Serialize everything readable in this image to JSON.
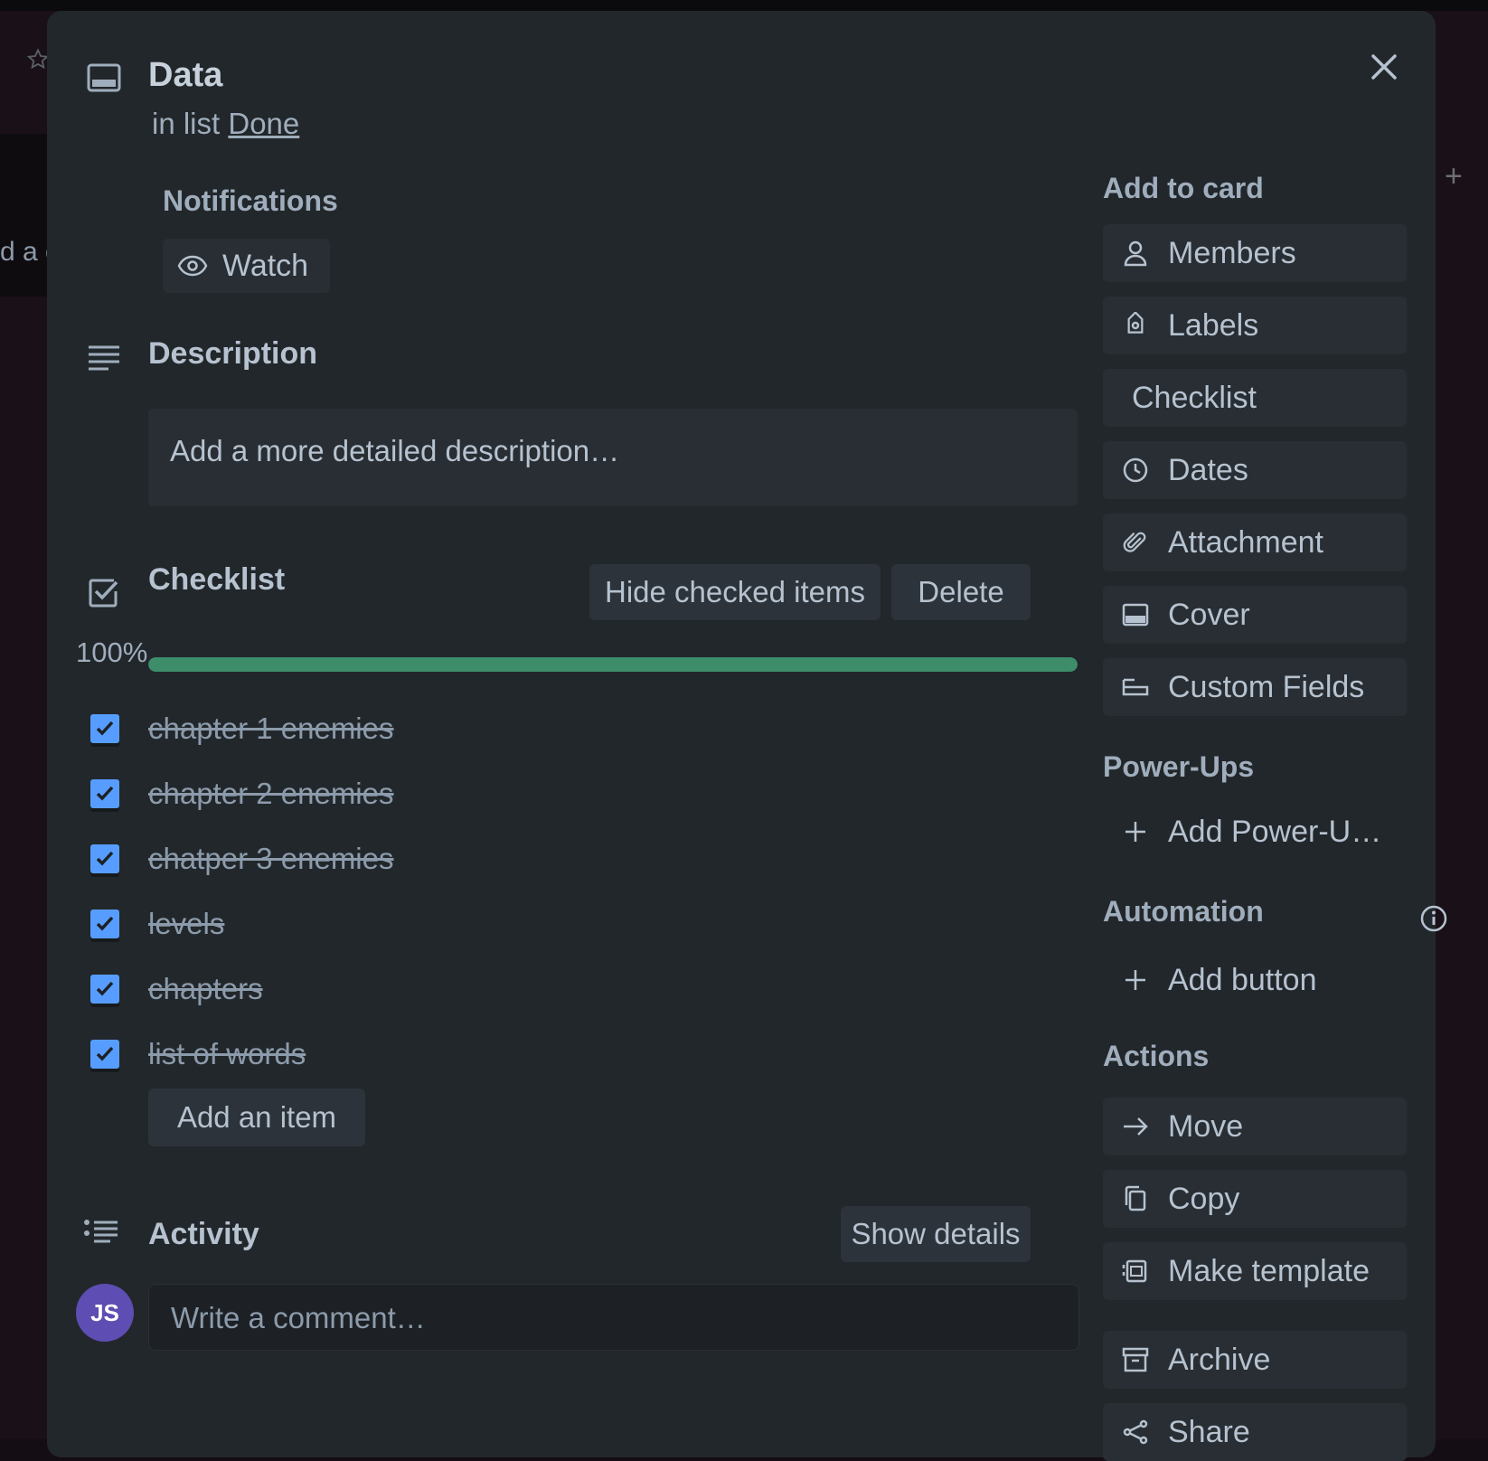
{
  "card": {
    "title": "Data",
    "list_prefix": "in list",
    "list_name": "Done"
  },
  "background": {
    "card_fragment": "d a c"
  },
  "notifications": {
    "heading": "Notifications",
    "watch_label": "Watch"
  },
  "description": {
    "heading": "Description",
    "placeholder": "Add a more detailed description…"
  },
  "checklist": {
    "heading": "Checklist",
    "hide_checked_label": "Hide checked items",
    "delete_label": "Delete",
    "progress_text": "100%",
    "progress_value": 1.0,
    "items": [
      {
        "label": "chapter 1 enemies",
        "checked": true
      },
      {
        "label": "chapter 2 enemies",
        "checked": true
      },
      {
        "label": "chatper 3 enemies",
        "checked": true
      },
      {
        "label": "levels",
        "checked": true
      },
      {
        "label": "chapters",
        "checked": true
      },
      {
        "label": "list of words",
        "checked": true
      }
    ],
    "add_item_label": "Add an item"
  },
  "activity": {
    "heading": "Activity",
    "show_details_label": "Show details",
    "avatar_initials": "JS",
    "comment_placeholder": "Write a comment…"
  },
  "sidebar": {
    "add_to_card_heading": "Add to card",
    "add_to_card": [
      {
        "label": "Members",
        "icon": "person-icon"
      },
      {
        "label": "Labels",
        "icon": "tag-icon"
      },
      {
        "label": "Checklist",
        "icon": ""
      },
      {
        "label": "Dates",
        "icon": "clock-icon"
      },
      {
        "label": "Attachment",
        "icon": "paperclip-icon"
      },
      {
        "label": "Cover",
        "icon": "cover-icon"
      },
      {
        "label": "Custom Fields",
        "icon": "custom-fields-icon"
      }
    ],
    "power_ups_heading": "Power-Ups",
    "add_power_up_label": "Add Power-U…",
    "automation_heading": "Automation",
    "add_button_label": "Add button",
    "actions_heading": "Actions",
    "actions": [
      {
        "label": "Move",
        "icon": "arrow-right-icon"
      },
      {
        "label": "Copy",
        "icon": "copy-icon"
      },
      {
        "label": "Make template",
        "icon": "template-icon"
      },
      {
        "label": "Archive",
        "icon": "archive-icon"
      },
      {
        "label": "Share",
        "icon": "share-icon"
      }
    ]
  },
  "colors": {
    "modal_bg": "#22272b",
    "button_bg": "#2c333a",
    "progress_complete": "#3d8c6a",
    "checkbox": "#579dff",
    "avatar": "#5e4db2"
  }
}
